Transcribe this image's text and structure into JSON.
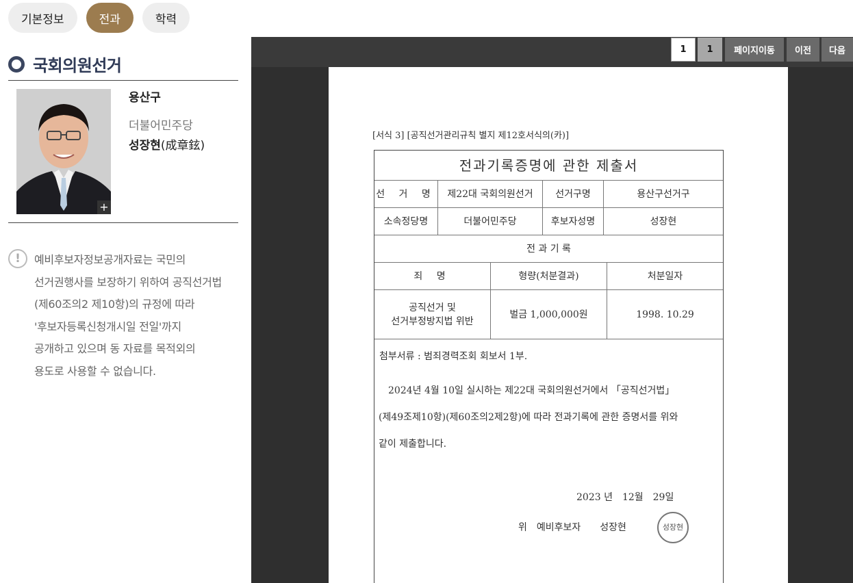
{
  "tabs": [
    {
      "label": "기본정보",
      "active": false
    },
    {
      "label": "전과",
      "active": true
    },
    {
      "label": "학력",
      "active": false
    }
  ],
  "section": {
    "title": "국회의원선거"
  },
  "candidate": {
    "district": "용산구",
    "party": "더불어민주당",
    "name_hangul": "성장현",
    "name_hanja": "(成章鉉)",
    "photo_expand": "+"
  },
  "notice": {
    "icon": "!",
    "lines": [
      "예비후보자정보공개자료는 국민의",
      "선거권행사를 보장하기 위하여 공직선거법",
      "(제60조의2 제10항)의 규정에 따라",
      "'후보자등록신청개시일 전일'까지",
      "공개하고 있으며 동 자료를 목적외의",
      "용도로 사용할 수 없습니다."
    ]
  },
  "viewer": {
    "current_page": "1",
    "total_pages": "1",
    "goto_label": "페이지이동",
    "prev_label": "이전",
    "next_label": "다음"
  },
  "document": {
    "form_header": "[서식 3] [공직선거관리규칙 별지 제12호서식의(카)]",
    "title": "전과기록증명에 관한 제출서",
    "election_label": "선 거 명",
    "election_value": "제22대 국회의원선거",
    "district_label": "선거구명",
    "district_value": "용산구선거구",
    "party_label": "소속정당명",
    "party_value": "더불어민주당",
    "candidate_label": "후보자성명",
    "candidate_value": "성장현",
    "record_header": "전 과 기 록",
    "col_crime": "죄 명",
    "col_penalty": "형량(처분결과)",
    "col_date": "처분일자",
    "crime_line1": "공직선거 및",
    "crime_line2": "선거부정방지법 위반",
    "penalty": "벌금 1,000,000원",
    "disposition_date": "1998. 10.29",
    "attachment": "첨부서류 : 범죄경력조회 회보서 1부.",
    "body_lines": [
      "　2024년 4월 10일 실시하는 제22대 국회의원선거에서 「공직선거법」",
      "(제49조제10항)(제60조의2제2항)에 따라 전과기록에 관한 증명서를 위와",
      "같이 제출합니다."
    ],
    "sign_date": "2023 년　12월　29일",
    "sign_line": "위　예비후보자　　성장현",
    "seal_text": "성장현"
  }
}
